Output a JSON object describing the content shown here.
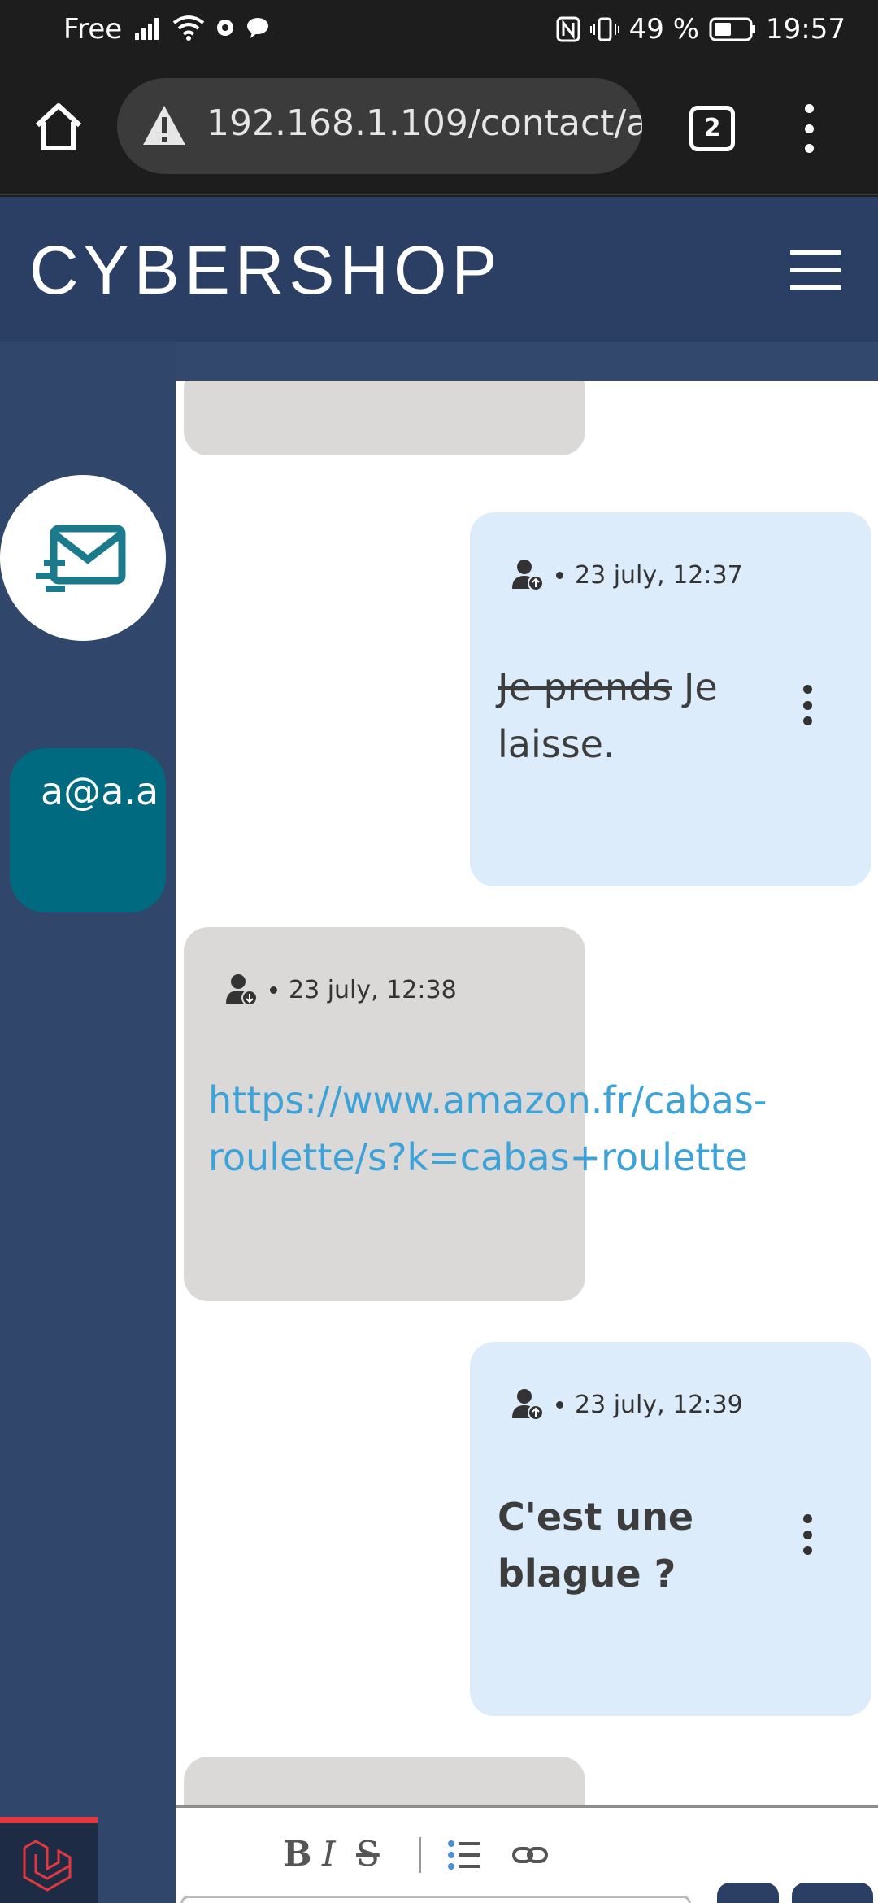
{
  "status_bar": {
    "carrier": "Free",
    "battery": "49 %",
    "time": "19:57"
  },
  "browser": {
    "url": "192.168.1.109/contact/a",
    "tab_count": "2"
  },
  "app": {
    "brand": "CYBERSHOP"
  },
  "sidebar": {
    "contact_email": "a@a.a"
  },
  "messages": [
    {
      "direction": "sent",
      "timestamp": "23 july, 12:37",
      "text_struck": "Je prends",
      "text": "Je laisse."
    },
    {
      "direction": "received",
      "timestamp": "23 july, 12:38",
      "link": "https://www.amazon.fr/cabas-roulette/s?k=cabas+roulette"
    },
    {
      "direction": "sent",
      "timestamp": "23 july, 12:39",
      "text": "C'est une blague ?"
    }
  ],
  "composer": {
    "bold": "B",
    "italic": "I",
    "strike": "S"
  },
  "colors": {
    "header": "#2b3e63",
    "sidebar": "#31466b",
    "contact_chip": "#006a80",
    "bubble_in": "#dbd8d8",
    "bubble_out": "#dcecfb",
    "link": "#3da2d8"
  }
}
